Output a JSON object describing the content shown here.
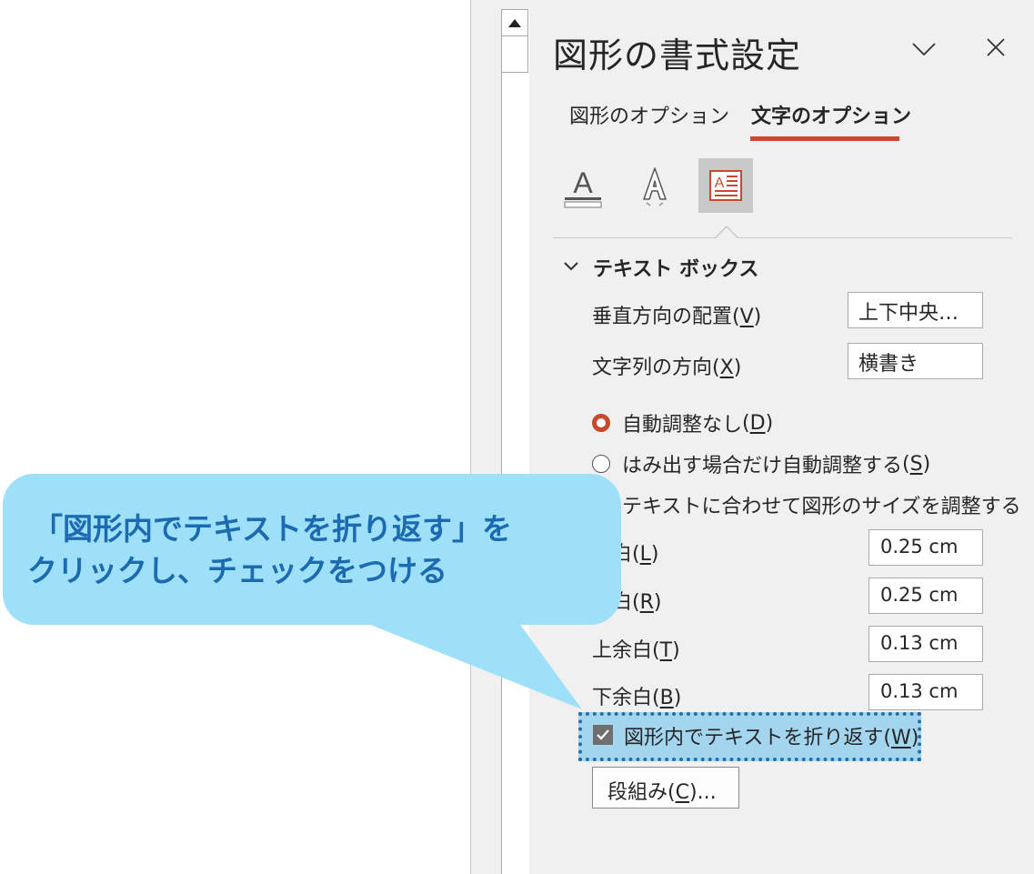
{
  "pane": {
    "title": "図形の書式設定",
    "tabs": [
      {
        "label": "図形のオプション",
        "active": false
      },
      {
        "label": "文字のオプション",
        "active": true
      }
    ],
    "format_icons": [
      "text-fill-outline-icon",
      "text-effects-icon",
      "textbox-layout-icon"
    ],
    "accent_color": "#c94a2a"
  },
  "section": {
    "title": "テキスト ボックス"
  },
  "vertical_alignment": {
    "label": "垂直方向の配置",
    "key": "V",
    "value": "上下中央…"
  },
  "text_direction": {
    "label": "文字列の方向",
    "key": "X",
    "value": "横書き"
  },
  "autofit": [
    {
      "label": "自動調整なし",
      "key": "D",
      "selected": true
    },
    {
      "label": "はみ出す場合だけ自動調整する",
      "key": "S",
      "selected": false
    },
    {
      "label": "テキストに合わせて図形のサイズを調整する",
      "selected": false
    }
  ],
  "margins": [
    {
      "label_visible": "余白",
      "key": "L",
      "value": "0.25 cm"
    },
    {
      "label_visible": "余白",
      "key": "R",
      "value": "0.25 cm"
    },
    {
      "label": "上余白",
      "key": "T",
      "value": "0.13 cm"
    },
    {
      "label": "下余白",
      "key": "B",
      "value": "0.13 cm"
    }
  ],
  "wrap_text": {
    "label": "図形内でテキストを折り返す",
    "key": "W",
    "checked": true
  },
  "columns_button": {
    "label": "段組み",
    "key": "C",
    "suffix": "..."
  },
  "callout": {
    "line1": "「図形内でテキストを折り返す」を",
    "line2": "クリックし、チェックをつける",
    "color": "#1c6ab0",
    "background": "#9ee0fa"
  }
}
